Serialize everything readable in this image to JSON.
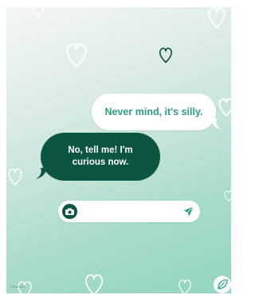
{
  "messages": {
    "outgoing": "Never mind, it's silly.",
    "incoming": "No, tell me! I'm curious now."
  },
  "composer": {
    "placeholder": "",
    "camera_icon": "camera-icon",
    "send_icon": "send-arrow-icon"
  },
  "footer": {
    "credit": "©2024 ACH"
  },
  "colors": {
    "accent_dark": "#0d5543",
    "accent_text": "#2f9f84",
    "background_top": "#f3f6f4",
    "background_bottom": "#93d5bd"
  },
  "decor": {
    "hearts_icon": "heart-outline-icon",
    "logo_icon": "leaf-logo-icon"
  }
}
